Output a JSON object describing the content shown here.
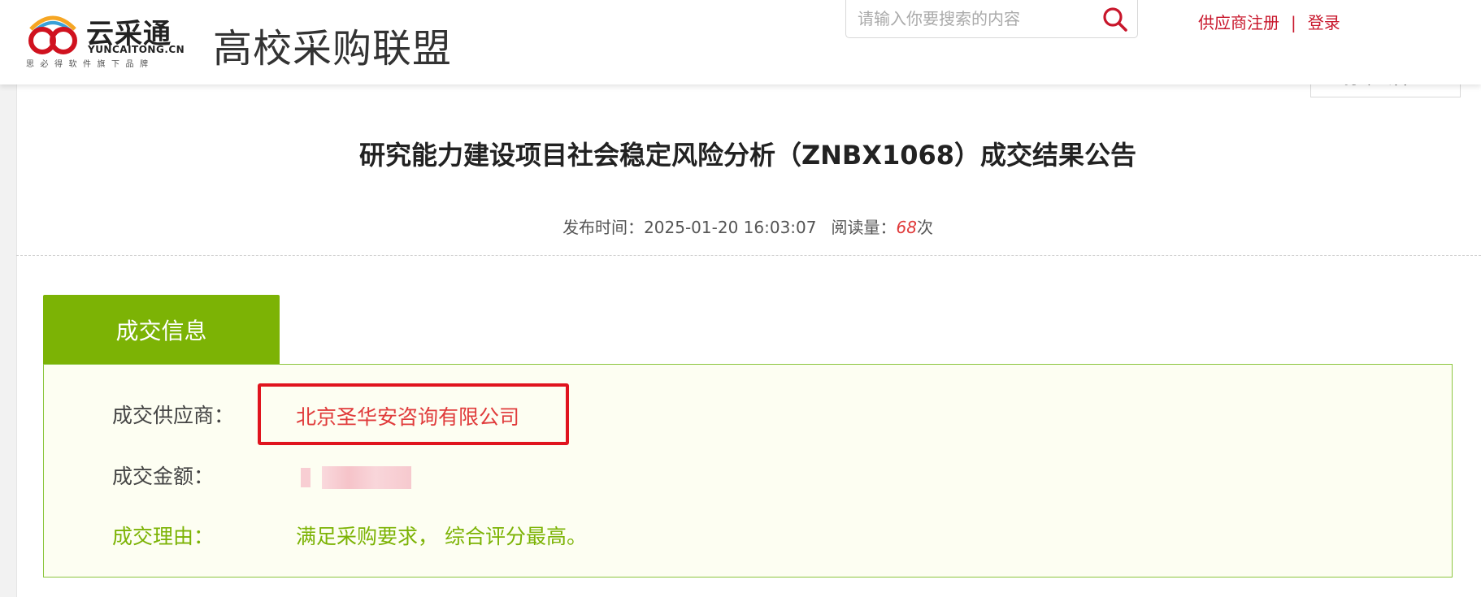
{
  "header": {
    "logo": {
      "brand_cn": "云采通",
      "brand_en": "YUNCAITONG.CN",
      "tagline": "思必得软件旗下品牌"
    },
    "site_title": "高校采购联盟",
    "search": {
      "placeholder": "请输入你要搜索的内容",
      "value": ""
    },
    "auth": {
      "register": "供应商注册",
      "separator": "|",
      "login": "登录"
    }
  },
  "notice": {
    "print_label": "打印公告",
    "title": "研究能力建设项目社会稳定风险分析（ZNBX1068）成交结果公告",
    "publish_label": "发布时间：",
    "publish_time": "2025-01-20 16:03:07",
    "read_label": "阅读量：",
    "read_count": "68",
    "read_unit": "次"
  },
  "deal_info": {
    "tab_label": "成交信息",
    "supplier_label": "成交供应商：",
    "supplier_value": "北京圣华安咨询有限公司",
    "amount_label": "成交金额：",
    "reason_label": "成交理由：",
    "reason_value": "满足采购要求， 综合评分最高。"
  },
  "colors": {
    "brand_red": "#c8162b",
    "accent_green": "#7cb305",
    "highlight_red": "#e0141e",
    "count_red": "#e03b3b"
  },
  "icons": {
    "search": "magnifier-icon",
    "print": "printer-icon",
    "logo": "interlocked-rings-logo"
  }
}
